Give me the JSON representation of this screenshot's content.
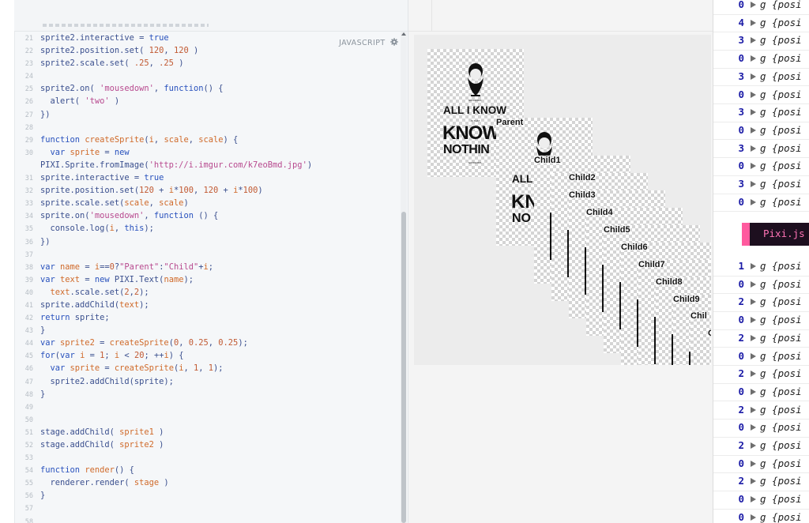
{
  "editor": {
    "language_label": "JAVASCRIPT",
    "lines": [
      {
        "n": "21",
        "parts": [
          [
            "plain",
            "sprite2.interactive = "
          ],
          [
            "kw",
            "true"
          ]
        ]
      },
      {
        "n": "22",
        "parts": [
          [
            "plain",
            "sprite2.position.set( "
          ],
          [
            "num",
            "120"
          ],
          [
            "plain",
            ", "
          ],
          [
            "num",
            "120"
          ],
          [
            "plain",
            " )"
          ]
        ]
      },
      {
        "n": "23",
        "parts": [
          [
            "plain",
            "sprite2.scale.set( "
          ],
          [
            "num",
            ".25"
          ],
          [
            "plain",
            ", "
          ],
          [
            "num",
            ".25"
          ],
          [
            "plain",
            " )"
          ]
        ]
      },
      {
        "n": "24",
        "parts": []
      },
      {
        "n": "25",
        "parts": [
          [
            "plain",
            "sprite2.on( "
          ],
          [
            "str",
            "'mousedown'"
          ],
          [
            "plain",
            ", "
          ],
          [
            "kw",
            "function"
          ],
          [
            "plain",
            "() {"
          ]
        ]
      },
      {
        "n": "26",
        "parts": [
          [
            "plain",
            "  alert( "
          ],
          [
            "str",
            "'two'"
          ],
          [
            "plain",
            " )"
          ]
        ]
      },
      {
        "n": "27",
        "parts": [
          [
            "plain",
            "})"
          ]
        ]
      },
      {
        "n": "28",
        "parts": []
      },
      {
        "n": "29",
        "parts": [
          [
            "kw",
            "function "
          ],
          [
            "fn",
            "createSprite"
          ],
          [
            "plain",
            "("
          ],
          [
            "fn",
            "i"
          ],
          [
            "plain",
            ", "
          ],
          [
            "fn",
            "scale"
          ],
          [
            "plain",
            ", "
          ],
          [
            "fn",
            "scale"
          ],
          [
            "plain",
            ") {"
          ]
        ]
      },
      {
        "n": "30",
        "parts": [
          [
            "plain",
            "  "
          ],
          [
            "kw",
            "var "
          ],
          [
            "fn",
            "sprite"
          ],
          [
            "plain",
            " = "
          ],
          [
            "kw",
            "new"
          ]
        ]
      },
      {
        "n": "",
        "parts": [
          [
            "plain",
            "PIXI.Sprite.fromImage("
          ],
          [
            "str",
            "'http://i.imgur.com/k7eoBmd.jpg'"
          ],
          [
            "plain",
            ")"
          ]
        ]
      },
      {
        "n": "31",
        "parts": [
          [
            "plain",
            "sprite.interactive = "
          ],
          [
            "kw",
            "true"
          ]
        ]
      },
      {
        "n": "32",
        "parts": [
          [
            "plain",
            "sprite.position.set("
          ],
          [
            "num",
            "120"
          ],
          [
            "plain",
            " + "
          ],
          [
            "fn",
            "i"
          ],
          [
            "plain",
            "*"
          ],
          [
            "num",
            "100"
          ],
          [
            "plain",
            ", "
          ],
          [
            "num",
            "120"
          ],
          [
            "plain",
            " + "
          ],
          [
            "fn",
            "i"
          ],
          [
            "plain",
            "*"
          ],
          [
            "num",
            "100"
          ],
          [
            "plain",
            ")"
          ]
        ]
      },
      {
        "n": "33",
        "parts": [
          [
            "plain",
            "sprite.scale.set("
          ],
          [
            "fn",
            "scale"
          ],
          [
            "plain",
            ", "
          ],
          [
            "fn",
            "scale"
          ],
          [
            "plain",
            ")"
          ]
        ]
      },
      {
        "n": "34",
        "parts": [
          [
            "plain",
            "sprite.on("
          ],
          [
            "str",
            "'mousedown'"
          ],
          [
            "plain",
            ", "
          ],
          [
            "kw",
            "function"
          ],
          [
            "plain",
            " () {"
          ]
        ]
      },
      {
        "n": "35",
        "parts": [
          [
            "plain",
            "  console.log("
          ],
          [
            "fn",
            "i"
          ],
          [
            "plain",
            ", "
          ],
          [
            "kw",
            "this"
          ],
          [
            "plain",
            ");"
          ]
        ]
      },
      {
        "n": "36",
        "parts": [
          [
            "plain",
            "})"
          ]
        ]
      },
      {
        "n": "37",
        "parts": []
      },
      {
        "n": "38",
        "parts": [
          [
            "kw",
            "var "
          ],
          [
            "fn",
            "name"
          ],
          [
            "plain",
            " = "
          ],
          [
            "fn",
            "i"
          ],
          [
            "plain",
            "=="
          ],
          [
            "num",
            "0"
          ],
          [
            "plain",
            "?"
          ],
          [
            "str",
            "\"Parent\""
          ],
          [
            "plain",
            ":"
          ],
          [
            "str",
            "\"Child\""
          ],
          [
            "plain",
            "+"
          ],
          [
            "fn",
            "i"
          ],
          [
            "plain",
            ";"
          ]
        ]
      },
      {
        "n": "39",
        "parts": [
          [
            "kw",
            "var "
          ],
          [
            "fn",
            "text"
          ],
          [
            "plain",
            " = "
          ],
          [
            "kw",
            "new "
          ],
          [
            "plain",
            "PIXI.Text("
          ],
          [
            "fn",
            "name"
          ],
          [
            "plain",
            ");"
          ]
        ]
      },
      {
        "n": "40",
        "parts": [
          [
            "plain",
            "  "
          ],
          [
            "fn",
            "text"
          ],
          [
            "plain",
            ".scale.set("
          ],
          [
            "num",
            "2"
          ],
          [
            "plain",
            ","
          ],
          [
            "num",
            "2"
          ],
          [
            "plain",
            ");"
          ]
        ]
      },
      {
        "n": "41",
        "parts": [
          [
            "plain",
            "sprite.addChild("
          ],
          [
            "fn",
            "text"
          ],
          [
            "plain",
            ");"
          ]
        ]
      },
      {
        "n": "42",
        "parts": [
          [
            "kw",
            "return "
          ],
          [
            "plain",
            "sprite;"
          ]
        ]
      },
      {
        "n": "43",
        "parts": [
          [
            "plain",
            "}"
          ]
        ]
      },
      {
        "n": "44",
        "parts": [
          [
            "kw",
            "var "
          ],
          [
            "fn",
            "sprite2"
          ],
          [
            "plain",
            " = "
          ],
          [
            "fn",
            "createSprite"
          ],
          [
            "plain",
            "("
          ],
          [
            "num",
            "0"
          ],
          [
            "plain",
            ", "
          ],
          [
            "num",
            "0.25"
          ],
          [
            "plain",
            ", "
          ],
          [
            "num",
            "0.25"
          ],
          [
            "plain",
            ");"
          ]
        ]
      },
      {
        "n": "45",
        "parts": [
          [
            "kw",
            "for"
          ],
          [
            "plain",
            "("
          ],
          [
            "kw",
            "var "
          ],
          [
            "fn",
            "i"
          ],
          [
            "plain",
            " = "
          ],
          [
            "num",
            "1"
          ],
          [
            "plain",
            "; "
          ],
          [
            "fn",
            "i"
          ],
          [
            "plain",
            " < "
          ],
          [
            "num",
            "20"
          ],
          [
            "plain",
            "; ++"
          ],
          [
            "fn",
            "i"
          ],
          [
            "plain",
            ") {"
          ]
        ]
      },
      {
        "n": "46",
        "parts": [
          [
            "plain",
            "  "
          ],
          [
            "kw",
            "var "
          ],
          [
            "fn",
            "sprite"
          ],
          [
            "plain",
            " = "
          ],
          [
            "fn",
            "createSprite"
          ],
          [
            "plain",
            "("
          ],
          [
            "fn",
            "i"
          ],
          [
            "plain",
            ", "
          ],
          [
            "num",
            "1"
          ],
          [
            "plain",
            ", "
          ],
          [
            "num",
            "1"
          ],
          [
            "plain",
            ");"
          ]
        ]
      },
      {
        "n": "47",
        "parts": [
          [
            "plain",
            "  sprite2.addChild(sprite);"
          ]
        ]
      },
      {
        "n": "48",
        "parts": [
          [
            "plain",
            "}"
          ]
        ]
      },
      {
        "n": "49",
        "parts": []
      },
      {
        "n": "50",
        "parts": []
      },
      {
        "n": "51",
        "parts": [
          [
            "plain",
            "stage.addChild( "
          ],
          [
            "fn",
            "sprite1"
          ],
          [
            "plain",
            " )"
          ]
        ]
      },
      {
        "n": "52",
        "parts": [
          [
            "plain",
            "stage.addChild( "
          ],
          [
            "fn",
            "sprite2"
          ],
          [
            "plain",
            " )"
          ]
        ]
      },
      {
        "n": "53",
        "parts": []
      },
      {
        "n": "54",
        "parts": [
          [
            "kw",
            "function "
          ],
          [
            "fn",
            "render"
          ],
          [
            "plain",
            "() {"
          ]
        ]
      },
      {
        "n": "55",
        "parts": [
          [
            "plain",
            "  renderer.render( "
          ],
          [
            "fn",
            "stage"
          ],
          [
            "plain",
            " )"
          ]
        ]
      },
      {
        "n": "56",
        "parts": [
          [
            "plain",
            "}"
          ]
        ]
      },
      {
        "n": "57",
        "parts": []
      },
      {
        "n": "58",
        "parts": []
      }
    ]
  },
  "preview": {
    "poster": {
      "line1": "ALL I KNOW",
      "line2": "KNOW",
      "line3": "NOTHIN",
      "small_top": "SOCRATES",
      "small_mid": "IS THAT",
      "small_bot": "SOCRATES"
    },
    "parent_poster": {
      "line1": "ALL",
      "line2": "KN",
      "line3": "NO"
    },
    "labels": [
      "Parent",
      "Child1",
      "Child2",
      "Child3",
      "Child4",
      "Child5",
      "Child6",
      "Child7",
      "Child8",
      "Child9",
      "Chil",
      "C"
    ]
  },
  "console": {
    "group_text": "g {posi",
    "rows_top": [
      "0",
      "4",
      "3",
      "0",
      "3",
      "0",
      "3",
      "0",
      "3",
      "0",
      "3",
      "0"
    ],
    "banner": "Pixi.js",
    "rows_bottom": [
      "1",
      "0",
      "2",
      "0",
      "2",
      "0",
      "2",
      "0",
      "2",
      "0",
      "2",
      "0",
      "2",
      "0",
      "0"
    ]
  },
  "colors": {
    "keyword": "#2851bd",
    "string": "#b84a8f",
    "number": "#c15a33",
    "banner_accent": "#ff5a9e"
  }
}
